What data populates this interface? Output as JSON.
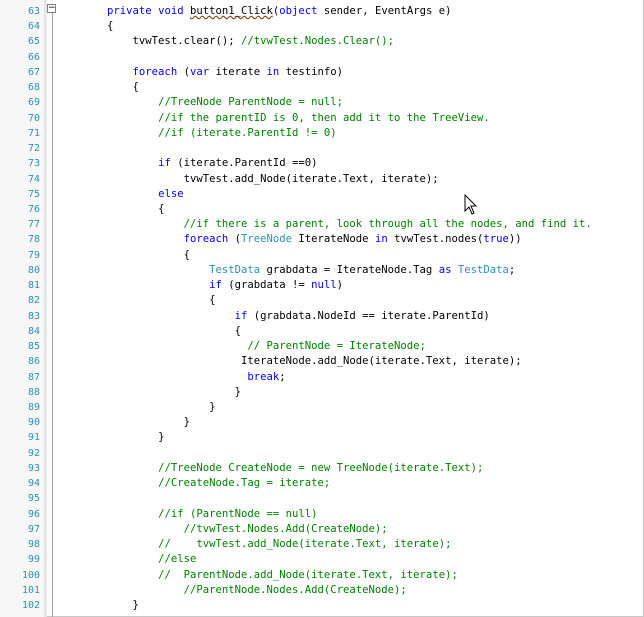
{
  "editor": {
    "line_numbers": [
      "63",
      "64",
      "65",
      "66",
      "67",
      "68",
      "69",
      "70",
      "71",
      "72",
      "73",
      "74",
      "75",
      "76",
      "77",
      "78",
      "79",
      "80",
      "81",
      "82",
      "83",
      "84",
      "85",
      "86",
      "87",
      "88",
      "89",
      "90",
      "91",
      "92",
      "93",
      "94",
      "95",
      "96",
      "97",
      "98",
      "99",
      "100",
      "101",
      "102"
    ],
    "lines": [
      {
        "indent": "        ",
        "tokens": [
          {
            "t": "private ",
            "c": "kw"
          },
          {
            "t": "void ",
            "c": "kw"
          },
          {
            "t": "button1_Click",
            "c": "pl",
            "sq": true
          },
          {
            "t": "(",
            "c": "pl"
          },
          {
            "t": "object",
            "c": "kw"
          },
          {
            "t": " sender, EventArgs e)",
            "c": "pl"
          }
        ]
      },
      {
        "indent": "        ",
        "tokens": [
          {
            "t": "{",
            "c": "pl"
          }
        ]
      },
      {
        "indent": "            ",
        "tokens": [
          {
            "t": "tvwTest.clear(); ",
            "c": "pl"
          },
          {
            "t": "//tvwTest.Nodes.Clear();",
            "c": "cm"
          }
        ]
      },
      {
        "indent": "",
        "tokens": []
      },
      {
        "indent": "            ",
        "tokens": [
          {
            "t": "foreach ",
            "c": "kw"
          },
          {
            "t": "(",
            "c": "pl"
          },
          {
            "t": "var ",
            "c": "kw"
          },
          {
            "t": "iterate ",
            "c": "pl"
          },
          {
            "t": "in ",
            "c": "kw"
          },
          {
            "t": "testinfo)",
            "c": "pl"
          }
        ]
      },
      {
        "indent": "            ",
        "tokens": [
          {
            "t": "{",
            "c": "pl"
          }
        ]
      },
      {
        "indent": "                ",
        "tokens": [
          {
            "t": "//TreeNode ParentNode = null;",
            "c": "cm"
          }
        ]
      },
      {
        "indent": "                ",
        "tokens": [
          {
            "t": "//if the parentID is 0, then add it to the TreeView.",
            "c": "cm"
          }
        ]
      },
      {
        "indent": "                ",
        "tokens": [
          {
            "t": "//if (iterate.ParentId != 0)",
            "c": "cm"
          }
        ]
      },
      {
        "indent": "",
        "tokens": []
      },
      {
        "indent": "                ",
        "tokens": [
          {
            "t": "if ",
            "c": "kw"
          },
          {
            "t": "(iterate.ParentId ==0)",
            "c": "pl"
          }
        ]
      },
      {
        "indent": "                    ",
        "tokens": [
          {
            "t": "tvwTest.add_Node(iterate.Text, iterate);",
            "c": "pl"
          }
        ]
      },
      {
        "indent": "                ",
        "tokens": [
          {
            "t": "else",
            "c": "kw"
          }
        ]
      },
      {
        "indent": "                ",
        "tokens": [
          {
            "t": "{",
            "c": "pl"
          }
        ]
      },
      {
        "indent": "                    ",
        "tokens": [
          {
            "t": "//if there is a parent, look through all the nodes, and find it.",
            "c": "cm"
          }
        ]
      },
      {
        "indent": "                    ",
        "tokens": [
          {
            "t": "foreach ",
            "c": "kw"
          },
          {
            "t": "(",
            "c": "pl"
          },
          {
            "t": "TreeNode ",
            "c": "ty"
          },
          {
            "t": "IterateNode ",
            "c": "pl"
          },
          {
            "t": "in ",
            "c": "kw"
          },
          {
            "t": "tvwTest.nodes(",
            "c": "pl"
          },
          {
            "t": "true",
            "c": "kw"
          },
          {
            "t": "))",
            "c": "pl"
          }
        ]
      },
      {
        "indent": "                    ",
        "tokens": [
          {
            "t": "{",
            "c": "pl"
          }
        ]
      },
      {
        "indent": "                        ",
        "tokens": [
          {
            "t": "TestData ",
            "c": "ty"
          },
          {
            "t": "grabdata = IterateNode.Tag ",
            "c": "pl"
          },
          {
            "t": "as ",
            "c": "kw"
          },
          {
            "t": "TestData",
            "c": "ty"
          },
          {
            "t": ";",
            "c": "pl"
          }
        ]
      },
      {
        "indent": "                        ",
        "tokens": [
          {
            "t": "if ",
            "c": "kw"
          },
          {
            "t": "(grabdata != ",
            "c": "pl"
          },
          {
            "t": "null",
            "c": "kw"
          },
          {
            "t": ")",
            "c": "pl"
          }
        ]
      },
      {
        "indent": "                        ",
        "tokens": [
          {
            "t": "{",
            "c": "pl"
          }
        ]
      },
      {
        "indent": "                            ",
        "tokens": [
          {
            "t": "if ",
            "c": "kw"
          },
          {
            "t": "(grabdata.NodeId == iterate.ParentId)",
            "c": "pl"
          }
        ]
      },
      {
        "indent": "                            ",
        "tokens": [
          {
            "t": "{",
            "c": "pl"
          }
        ]
      },
      {
        "indent": "                              ",
        "tokens": [
          {
            "t": "// ParentNode = IterateNode;",
            "c": "cm"
          }
        ]
      },
      {
        "indent": "                             ",
        "tokens": [
          {
            "t": "IterateNode.add_Node(iterate.Text, iterate);",
            "c": "pl"
          }
        ]
      },
      {
        "indent": "                              ",
        "tokens": [
          {
            "t": "break",
            "c": "kw"
          },
          {
            "t": ";",
            "c": "pl"
          }
        ]
      },
      {
        "indent": "                            ",
        "tokens": [
          {
            "t": "}",
            "c": "pl"
          }
        ]
      },
      {
        "indent": "                        ",
        "tokens": [
          {
            "t": "}",
            "c": "pl"
          }
        ]
      },
      {
        "indent": "                    ",
        "tokens": [
          {
            "t": "}",
            "c": "pl"
          }
        ]
      },
      {
        "indent": "                ",
        "tokens": [
          {
            "t": "}",
            "c": "pl"
          }
        ]
      },
      {
        "indent": "",
        "tokens": []
      },
      {
        "indent": "                ",
        "tokens": [
          {
            "t": "//TreeNode CreateNode = new TreeNode(iterate.Text);",
            "c": "cm"
          }
        ]
      },
      {
        "indent": "                ",
        "tokens": [
          {
            "t": "//CreateNode.Tag = iterate;",
            "c": "cm"
          }
        ]
      },
      {
        "indent": "",
        "tokens": []
      },
      {
        "indent": "                ",
        "tokens": [
          {
            "t": "//if (ParentNode == null)",
            "c": "cm"
          }
        ]
      },
      {
        "indent": "                    ",
        "tokens": [
          {
            "t": "//tvwTest.Nodes.Add(CreateNode);",
            "c": "cm"
          }
        ]
      },
      {
        "indent": "                ",
        "tokens": [
          {
            "t": "//    tvwTest.add_Node(iterate.Text, iterate);",
            "c": "cm"
          }
        ]
      },
      {
        "indent": "                ",
        "tokens": [
          {
            "t": "//else",
            "c": "cm"
          }
        ]
      },
      {
        "indent": "                ",
        "tokens": [
          {
            "t": "//  ParentNode.add_Node(iterate.Text, iterate);",
            "c": "cm"
          }
        ]
      },
      {
        "indent": "                    ",
        "tokens": [
          {
            "t": "//ParentNode.Nodes.Add(CreateNode);",
            "c": "cm"
          }
        ]
      },
      {
        "indent": "            ",
        "tokens": [
          {
            "t": "}",
            "c": "pl"
          }
        ]
      }
    ],
    "collapse_glyph": "−"
  }
}
